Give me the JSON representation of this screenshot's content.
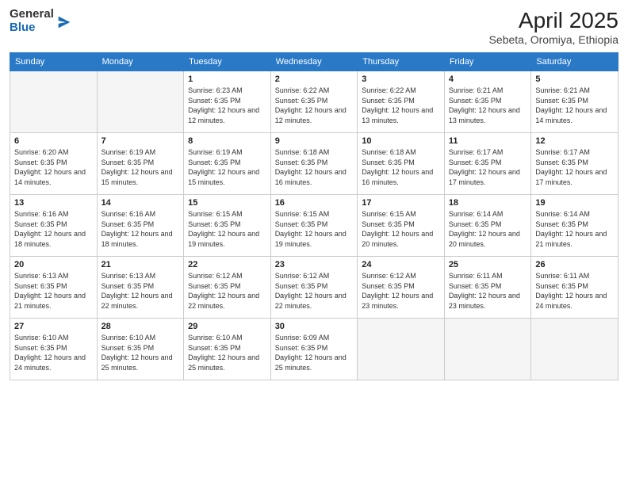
{
  "header": {
    "logo": {
      "line1": "General",
      "line2": "Blue"
    },
    "title": "April 2025",
    "location": "Sebeta, Oromiya, Ethiopia"
  },
  "weekdays": [
    "Sunday",
    "Monday",
    "Tuesday",
    "Wednesday",
    "Thursday",
    "Friday",
    "Saturday"
  ],
  "weeks": [
    [
      {
        "day": "",
        "empty": true
      },
      {
        "day": "",
        "empty": true
      },
      {
        "day": "1",
        "sunrise": "6:23 AM",
        "sunset": "6:35 PM",
        "daylight": "12 hours and 12 minutes."
      },
      {
        "day": "2",
        "sunrise": "6:22 AM",
        "sunset": "6:35 PM",
        "daylight": "12 hours and 12 minutes."
      },
      {
        "day": "3",
        "sunrise": "6:22 AM",
        "sunset": "6:35 PM",
        "daylight": "12 hours and 13 minutes."
      },
      {
        "day": "4",
        "sunrise": "6:21 AM",
        "sunset": "6:35 PM",
        "daylight": "12 hours and 13 minutes."
      },
      {
        "day": "5",
        "sunrise": "6:21 AM",
        "sunset": "6:35 PM",
        "daylight": "12 hours and 14 minutes."
      }
    ],
    [
      {
        "day": "6",
        "sunrise": "6:20 AM",
        "sunset": "6:35 PM",
        "daylight": "12 hours and 14 minutes."
      },
      {
        "day": "7",
        "sunrise": "6:19 AM",
        "sunset": "6:35 PM",
        "daylight": "12 hours and 15 minutes."
      },
      {
        "day": "8",
        "sunrise": "6:19 AM",
        "sunset": "6:35 PM",
        "daylight": "12 hours and 15 minutes."
      },
      {
        "day": "9",
        "sunrise": "6:18 AM",
        "sunset": "6:35 PM",
        "daylight": "12 hours and 16 minutes."
      },
      {
        "day": "10",
        "sunrise": "6:18 AM",
        "sunset": "6:35 PM",
        "daylight": "12 hours and 16 minutes."
      },
      {
        "day": "11",
        "sunrise": "6:17 AM",
        "sunset": "6:35 PM",
        "daylight": "12 hours and 17 minutes."
      },
      {
        "day": "12",
        "sunrise": "6:17 AM",
        "sunset": "6:35 PM",
        "daylight": "12 hours and 17 minutes."
      }
    ],
    [
      {
        "day": "13",
        "sunrise": "6:16 AM",
        "sunset": "6:35 PM",
        "daylight": "12 hours and 18 minutes."
      },
      {
        "day": "14",
        "sunrise": "6:16 AM",
        "sunset": "6:35 PM",
        "daylight": "12 hours and 18 minutes."
      },
      {
        "day": "15",
        "sunrise": "6:15 AM",
        "sunset": "6:35 PM",
        "daylight": "12 hours and 19 minutes."
      },
      {
        "day": "16",
        "sunrise": "6:15 AM",
        "sunset": "6:35 PM",
        "daylight": "12 hours and 19 minutes."
      },
      {
        "day": "17",
        "sunrise": "6:15 AM",
        "sunset": "6:35 PM",
        "daylight": "12 hours and 20 minutes."
      },
      {
        "day": "18",
        "sunrise": "6:14 AM",
        "sunset": "6:35 PM",
        "daylight": "12 hours and 20 minutes."
      },
      {
        "day": "19",
        "sunrise": "6:14 AM",
        "sunset": "6:35 PM",
        "daylight": "12 hours and 21 minutes."
      }
    ],
    [
      {
        "day": "20",
        "sunrise": "6:13 AM",
        "sunset": "6:35 PM",
        "daylight": "12 hours and 21 minutes."
      },
      {
        "day": "21",
        "sunrise": "6:13 AM",
        "sunset": "6:35 PM",
        "daylight": "12 hours and 22 minutes."
      },
      {
        "day": "22",
        "sunrise": "6:12 AM",
        "sunset": "6:35 PM",
        "daylight": "12 hours and 22 minutes."
      },
      {
        "day": "23",
        "sunrise": "6:12 AM",
        "sunset": "6:35 PM",
        "daylight": "12 hours and 22 minutes."
      },
      {
        "day": "24",
        "sunrise": "6:12 AM",
        "sunset": "6:35 PM",
        "daylight": "12 hours and 23 minutes."
      },
      {
        "day": "25",
        "sunrise": "6:11 AM",
        "sunset": "6:35 PM",
        "daylight": "12 hours and 23 minutes."
      },
      {
        "day": "26",
        "sunrise": "6:11 AM",
        "sunset": "6:35 PM",
        "daylight": "12 hours and 24 minutes."
      }
    ],
    [
      {
        "day": "27",
        "sunrise": "6:10 AM",
        "sunset": "6:35 PM",
        "daylight": "12 hours and 24 minutes."
      },
      {
        "day": "28",
        "sunrise": "6:10 AM",
        "sunset": "6:35 PM",
        "daylight": "12 hours and 25 minutes."
      },
      {
        "day": "29",
        "sunrise": "6:10 AM",
        "sunset": "6:35 PM",
        "daylight": "12 hours and 25 minutes."
      },
      {
        "day": "30",
        "sunrise": "6:09 AM",
        "sunset": "6:35 PM",
        "daylight": "12 hours and 25 minutes."
      },
      {
        "day": "",
        "empty": true
      },
      {
        "day": "",
        "empty": true
      },
      {
        "day": "",
        "empty": true
      }
    ]
  ]
}
